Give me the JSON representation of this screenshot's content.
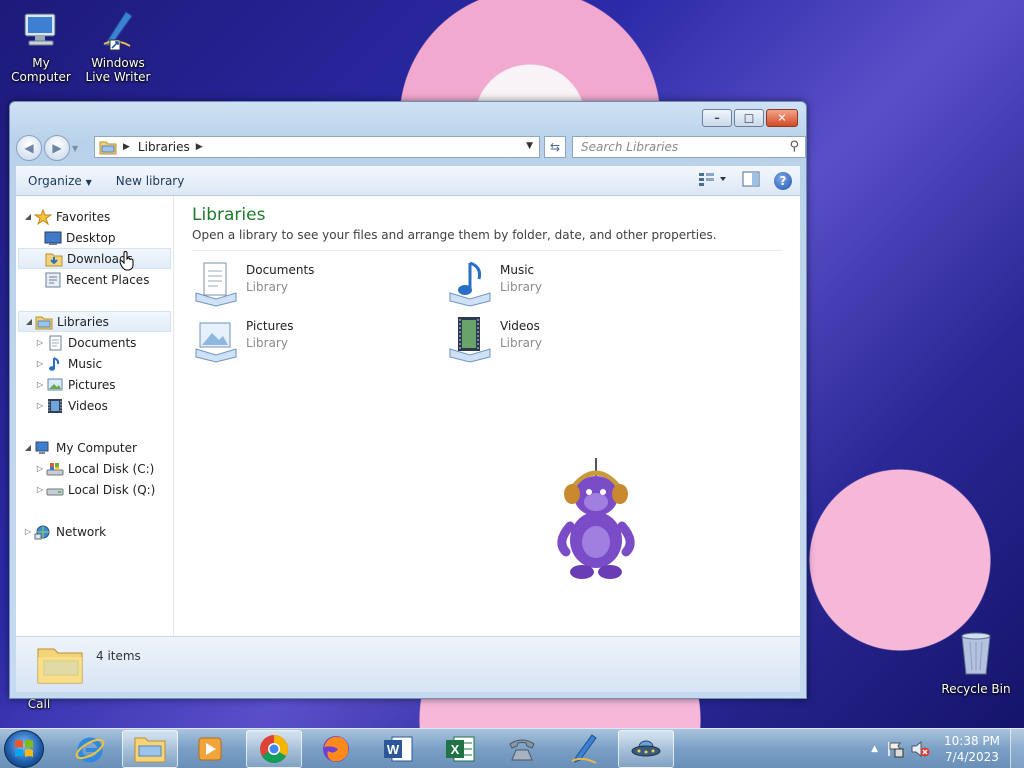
{
  "desktop": {
    "icons": [
      {
        "label": "My Computer"
      },
      {
        "label": "Windows Live Writer"
      },
      {
        "label": "Recycle Bin"
      }
    ],
    "partial_label": "Call"
  },
  "window": {
    "address": {
      "location": "Libraries"
    },
    "search": {
      "placeholder": "Search Libraries"
    },
    "toolbar": {
      "organize": "Organize",
      "new_library": "New library"
    },
    "navpane": {
      "favorites": {
        "label": "Favorites",
        "items": [
          "Desktop",
          "Downloads",
          "Recent Places"
        ]
      },
      "libraries": {
        "label": "Libraries",
        "items": [
          "Documents",
          "Music",
          "Pictures",
          "Videos"
        ]
      },
      "computer": {
        "label": "My Computer",
        "items": [
          "Local Disk (C:)",
          "Local Disk (Q:)"
        ]
      },
      "network": {
        "label": "Network"
      }
    },
    "content": {
      "title": "Libraries",
      "subtitle": "Open a library to see your files and arrange them by folder, date, and other properties.",
      "libraries": [
        {
          "name": "Documents",
          "type": "Library",
          "icon": "documents-icon"
        },
        {
          "name": "Music",
          "type": "Library",
          "icon": "music-icon"
        },
        {
          "name": "Pictures",
          "type": "Library",
          "icon": "pictures-icon"
        },
        {
          "name": "Videos",
          "type": "Library",
          "icon": "videos-icon"
        }
      ]
    },
    "status": {
      "count": "4 items"
    }
  },
  "taskbar": {
    "clock": {
      "time": "10:38 PM",
      "date": "7/4/2023"
    },
    "apps": [
      "internet-explorer-icon",
      "explorer-icon",
      "media-player-icon",
      "chrome-icon",
      "firefox-icon",
      "word-icon",
      "excel-icon",
      "phone-icon",
      "writer-icon",
      "ufo-icon"
    ]
  }
}
